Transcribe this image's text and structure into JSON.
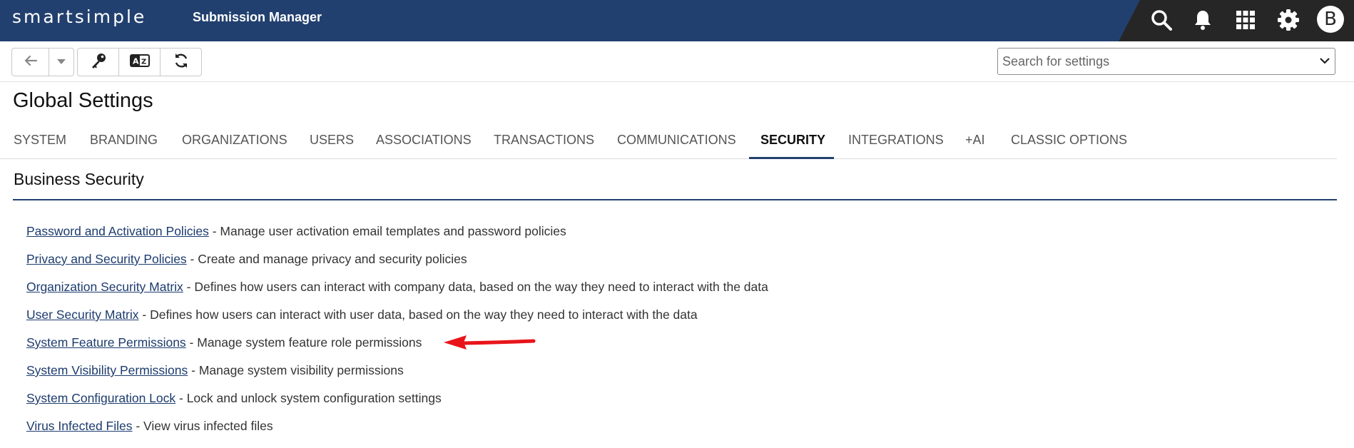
{
  "header": {
    "logo": "smartsimple",
    "app_title": "Submission Manager",
    "avatar_letter": "B",
    "icons": [
      "search-icon",
      "bell-icon",
      "apps-grid-icon",
      "gear-icon"
    ]
  },
  "toolbar": {
    "buttons": [
      "back-arrow-icon",
      "dropdown-caret-icon",
      "key-icon",
      "language-icon",
      "refresh-icon"
    ],
    "search_placeholder": "Search for settings"
  },
  "page": {
    "title": "Global Settings",
    "tabs": [
      {
        "label": "SYSTEM",
        "active": false
      },
      {
        "label": "BRANDING",
        "active": false
      },
      {
        "label": "ORGANIZATIONS",
        "active": false
      },
      {
        "label": "USERS",
        "active": false
      },
      {
        "label": "ASSOCIATIONS",
        "active": false
      },
      {
        "label": "TRANSACTIONS",
        "active": false
      },
      {
        "label": "COMMUNICATIONS",
        "active": false
      },
      {
        "label": "SECURITY",
        "active": true
      },
      {
        "label": "INTEGRATIONS",
        "active": false
      },
      {
        "label": "+AI",
        "active": false
      },
      {
        "label": "CLASSIC OPTIONS",
        "active": false
      }
    ]
  },
  "section": {
    "title": "Business Security",
    "items": [
      {
        "link": "Password and Activation Policies",
        "desc": " - Manage user activation email templates and password policies"
      },
      {
        "link": "Privacy and Security Policies",
        "desc": " - Create and manage privacy and security policies"
      },
      {
        "link": "Organization Security Matrix",
        "desc": " - Defines how users can interact with company data, based on the way they need to interact with the data"
      },
      {
        "link": "User Security Matrix",
        "desc": " - Defines how users can interact with user data, based on the way they need to interact with the data"
      },
      {
        "link": "System Feature Permissions",
        "desc": " - Manage system feature role permissions"
      },
      {
        "link": "System Visibility Permissions",
        "desc": " - Manage system visibility permissions"
      },
      {
        "link": "System Configuration Lock",
        "desc": " - Lock and unlock system configuration settings"
      },
      {
        "link": "Virus Infected Files",
        "desc": " - View virus infected files"
      }
    ]
  },
  "colors": {
    "header_bg": "#22406f",
    "header_right_bg": "#262626",
    "link": "#1c3b6e",
    "annotation_arrow": "#e8141a"
  }
}
